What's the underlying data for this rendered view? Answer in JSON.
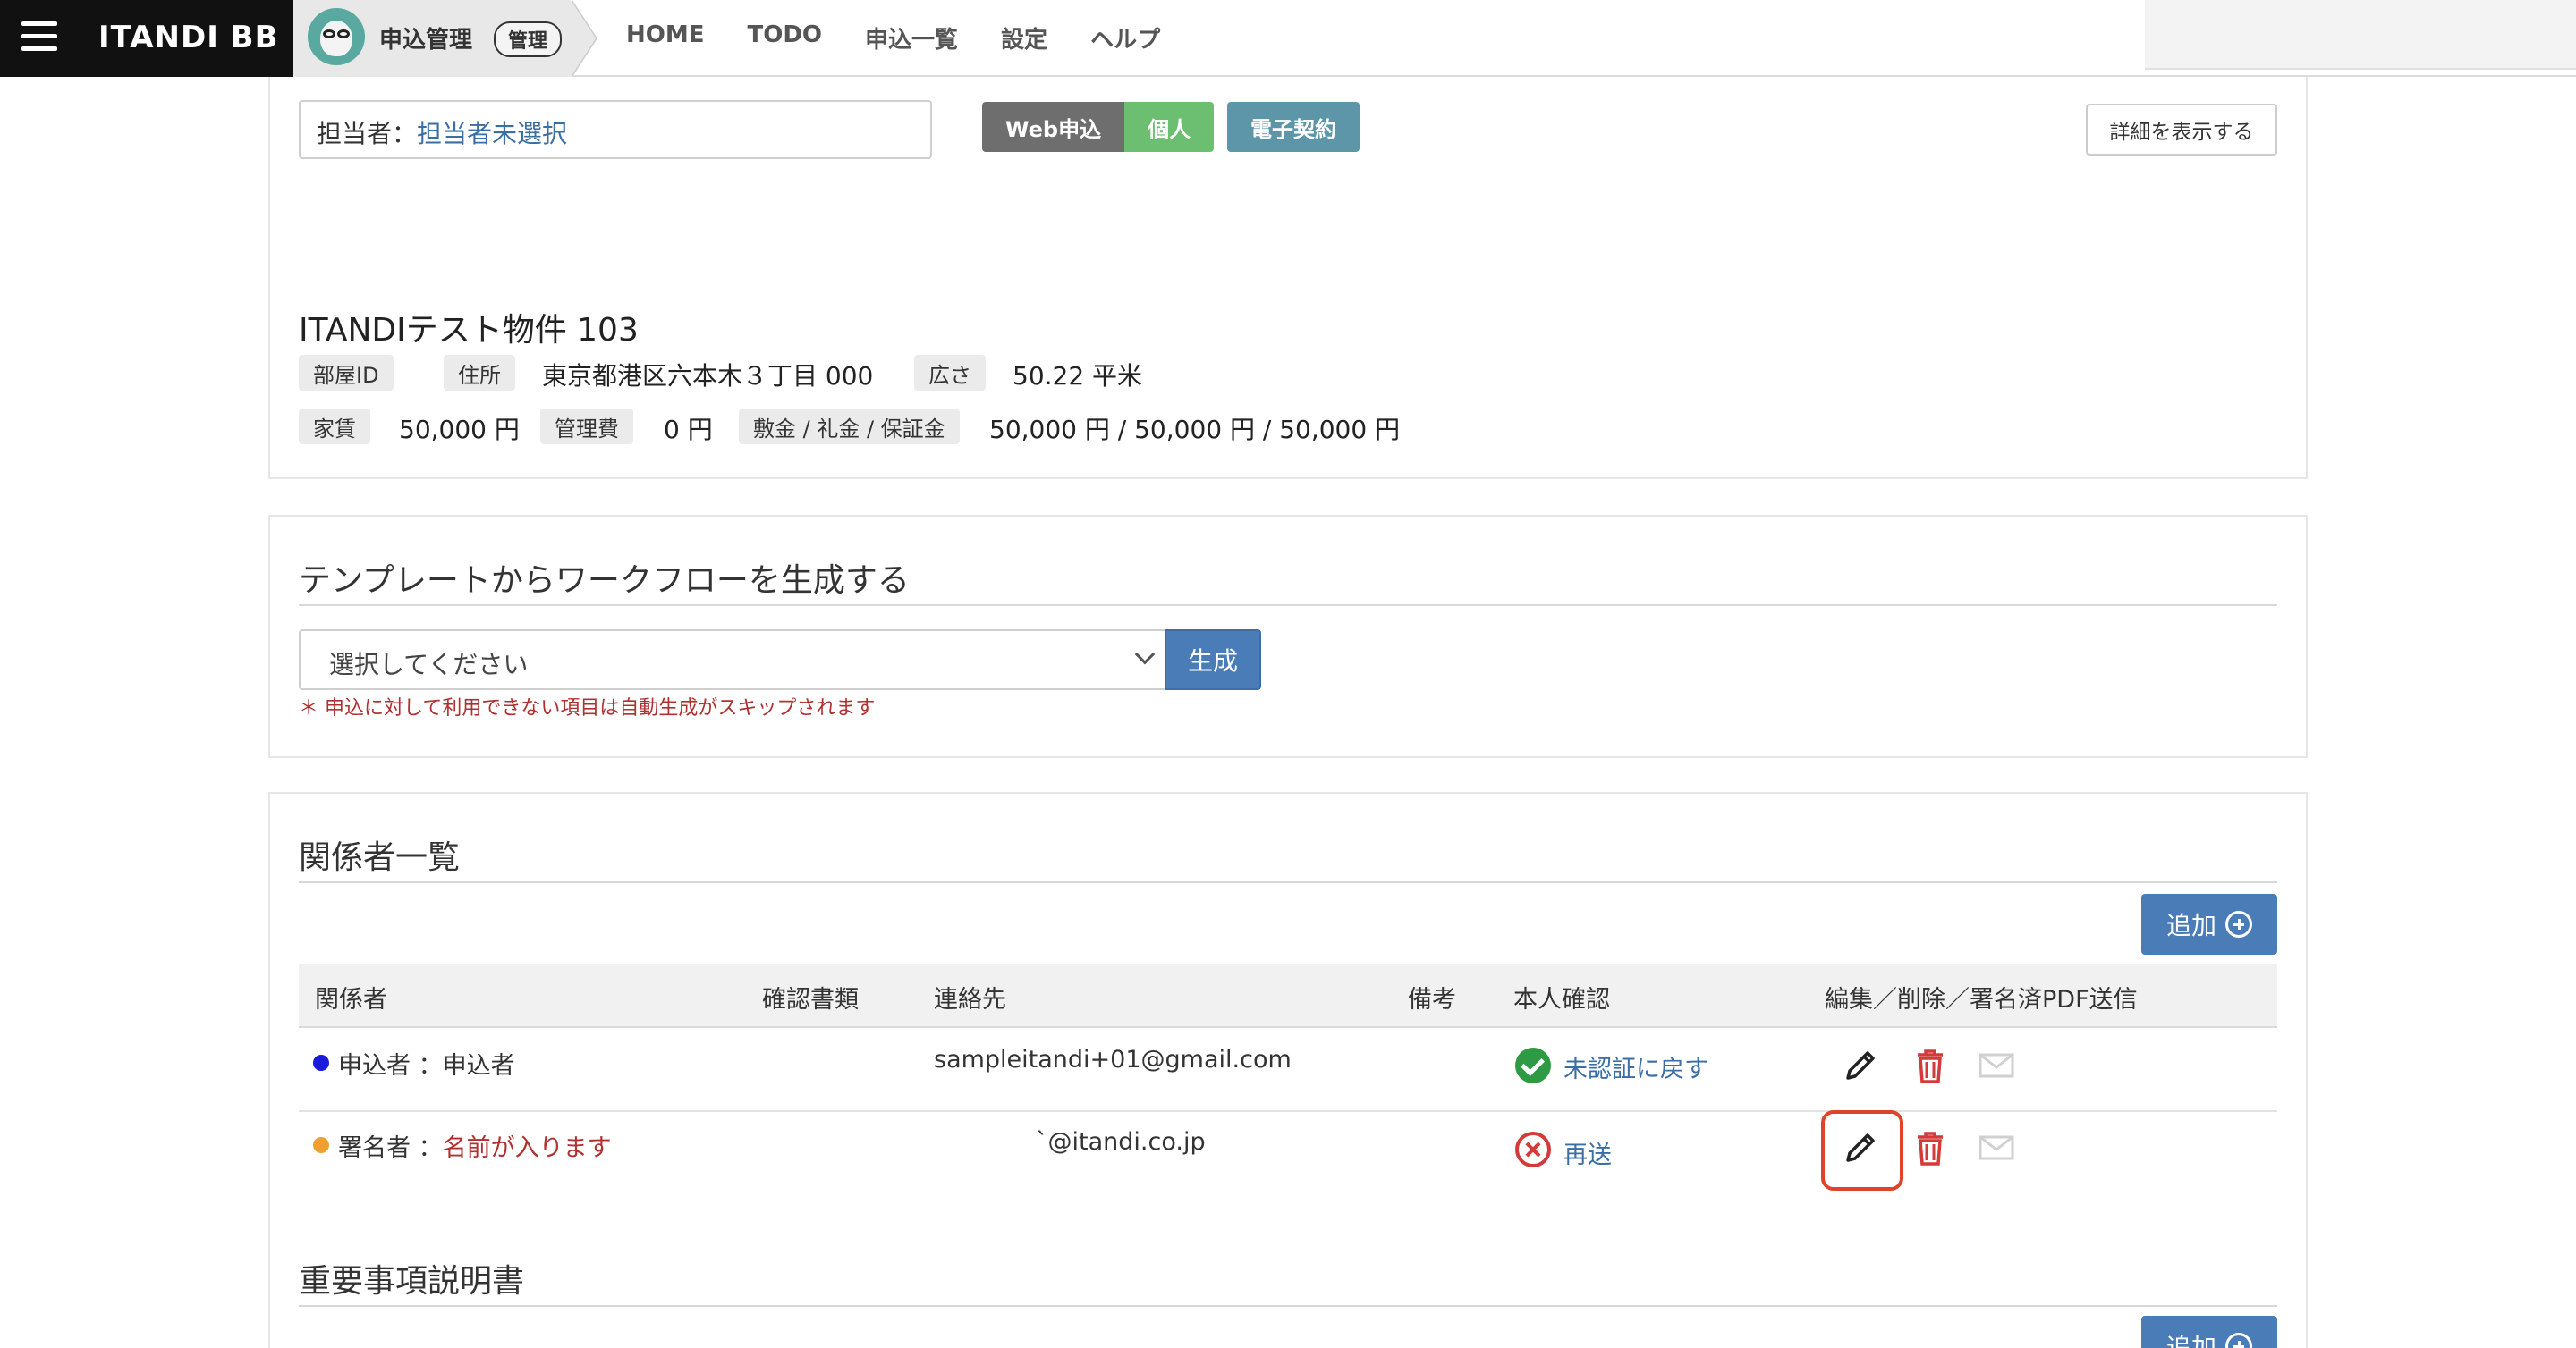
{
  "topbar": {
    "brand": "ITANDI BB",
    "app_title": "申込管理",
    "app_badge": "管理",
    "nav": [
      "HOME",
      "TODO",
      "申込一覧",
      "設定",
      "ヘルプ"
    ]
  },
  "header": {
    "assignee_label": "担当者：",
    "assignee_value": "担当者未選択",
    "tag_web": "Web申込",
    "tag_kojin": "個人",
    "tag_keiyaku": "電子契約",
    "detail_button": "詳細を表示する"
  },
  "property": {
    "name": "ITANDIテスト物件 103",
    "room_id_label": "部屋ID",
    "address_label": "住所",
    "address_value": "東京都港区六本木３丁目 000",
    "area_label": "広さ",
    "area_value": "50.22 平米",
    "rent_label": "家賃",
    "rent_value": "50,000 円",
    "fee_label": "管理費",
    "fee_value": "0 円",
    "deposit_label": "敷金 / 礼金 / 保証金",
    "deposit_value": "50,000 円 / 50,000 円 / 50,000 円"
  },
  "workflow": {
    "title": "テンプレートからワークフローを生成する",
    "select_value": "選択してください",
    "generate_button": "生成",
    "note": "＊ 申込に対して利用できない項目は自動生成がスキップされます"
  },
  "parties": {
    "title": "関係者一覧",
    "add_button": "追加",
    "columns": [
      "関係者",
      "確認書類",
      "連絡先",
      "備考",
      "本人確認",
      "編集／削除／署名済PDF送信"
    ],
    "rows": [
      {
        "dot_color": "#1a1adb",
        "role": "申込者",
        "sep": "：",
        "name": "申込者",
        "contact": "sampleitandi+01@gmail.com",
        "status_icon": "check-icon",
        "status_text": "未認証に戻す"
      },
      {
        "dot_color": "#f0a030",
        "role": "署名者",
        "sep": "：",
        "name": "名前が入ります",
        "contact": "`@itandi.co.jp",
        "status_icon": "x-circle-icon",
        "status_text": "再送"
      }
    ]
  },
  "important": {
    "title": "重要事項説明書",
    "add_button": "追加"
  },
  "colors": {
    "primary": "#4a7db8",
    "danger": "#d43a3a",
    "success": "#2e9a44",
    "highlight": "#e0432c"
  }
}
